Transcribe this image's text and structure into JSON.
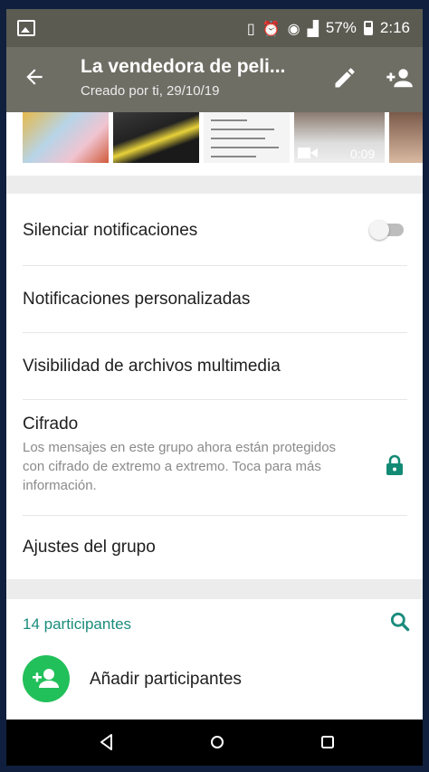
{
  "status_bar": {
    "battery": "57%",
    "time": "2:16",
    "icons": [
      "image-icon",
      "vibrate-icon",
      "alarm-icon",
      "wifi-icon",
      "signal-icon",
      "battery-icon"
    ]
  },
  "header": {
    "title": "La vendedora de peli...",
    "subtitle": "Creado por ti, 29/10/19",
    "icons": [
      "back-arrow-icon",
      "edit-pencil-icon",
      "add-person-icon"
    ]
  },
  "media": {
    "video_duration": "0:09"
  },
  "settings": {
    "mute_label": "Silenciar notificaciones",
    "mute_enabled": false,
    "custom_notifications_label": "Notificaciones personalizadas",
    "media_visibility_label": "Visibilidad de archivos multimedia",
    "encryption_title": "Cifrado",
    "encryption_desc": "Los mensajes en este grupo ahora están protegidos con cifrado de extremo a extremo. Toca para más información.",
    "group_settings_label": "Ajustes del grupo"
  },
  "participants": {
    "count_label": "14 participantes",
    "add_label": "Añadir participantes"
  },
  "colors": {
    "accent": "#1a8c7c",
    "header_bg": "#6e6e65",
    "status_bg": "#5b5b52",
    "add_avatar": "#22c05a"
  }
}
